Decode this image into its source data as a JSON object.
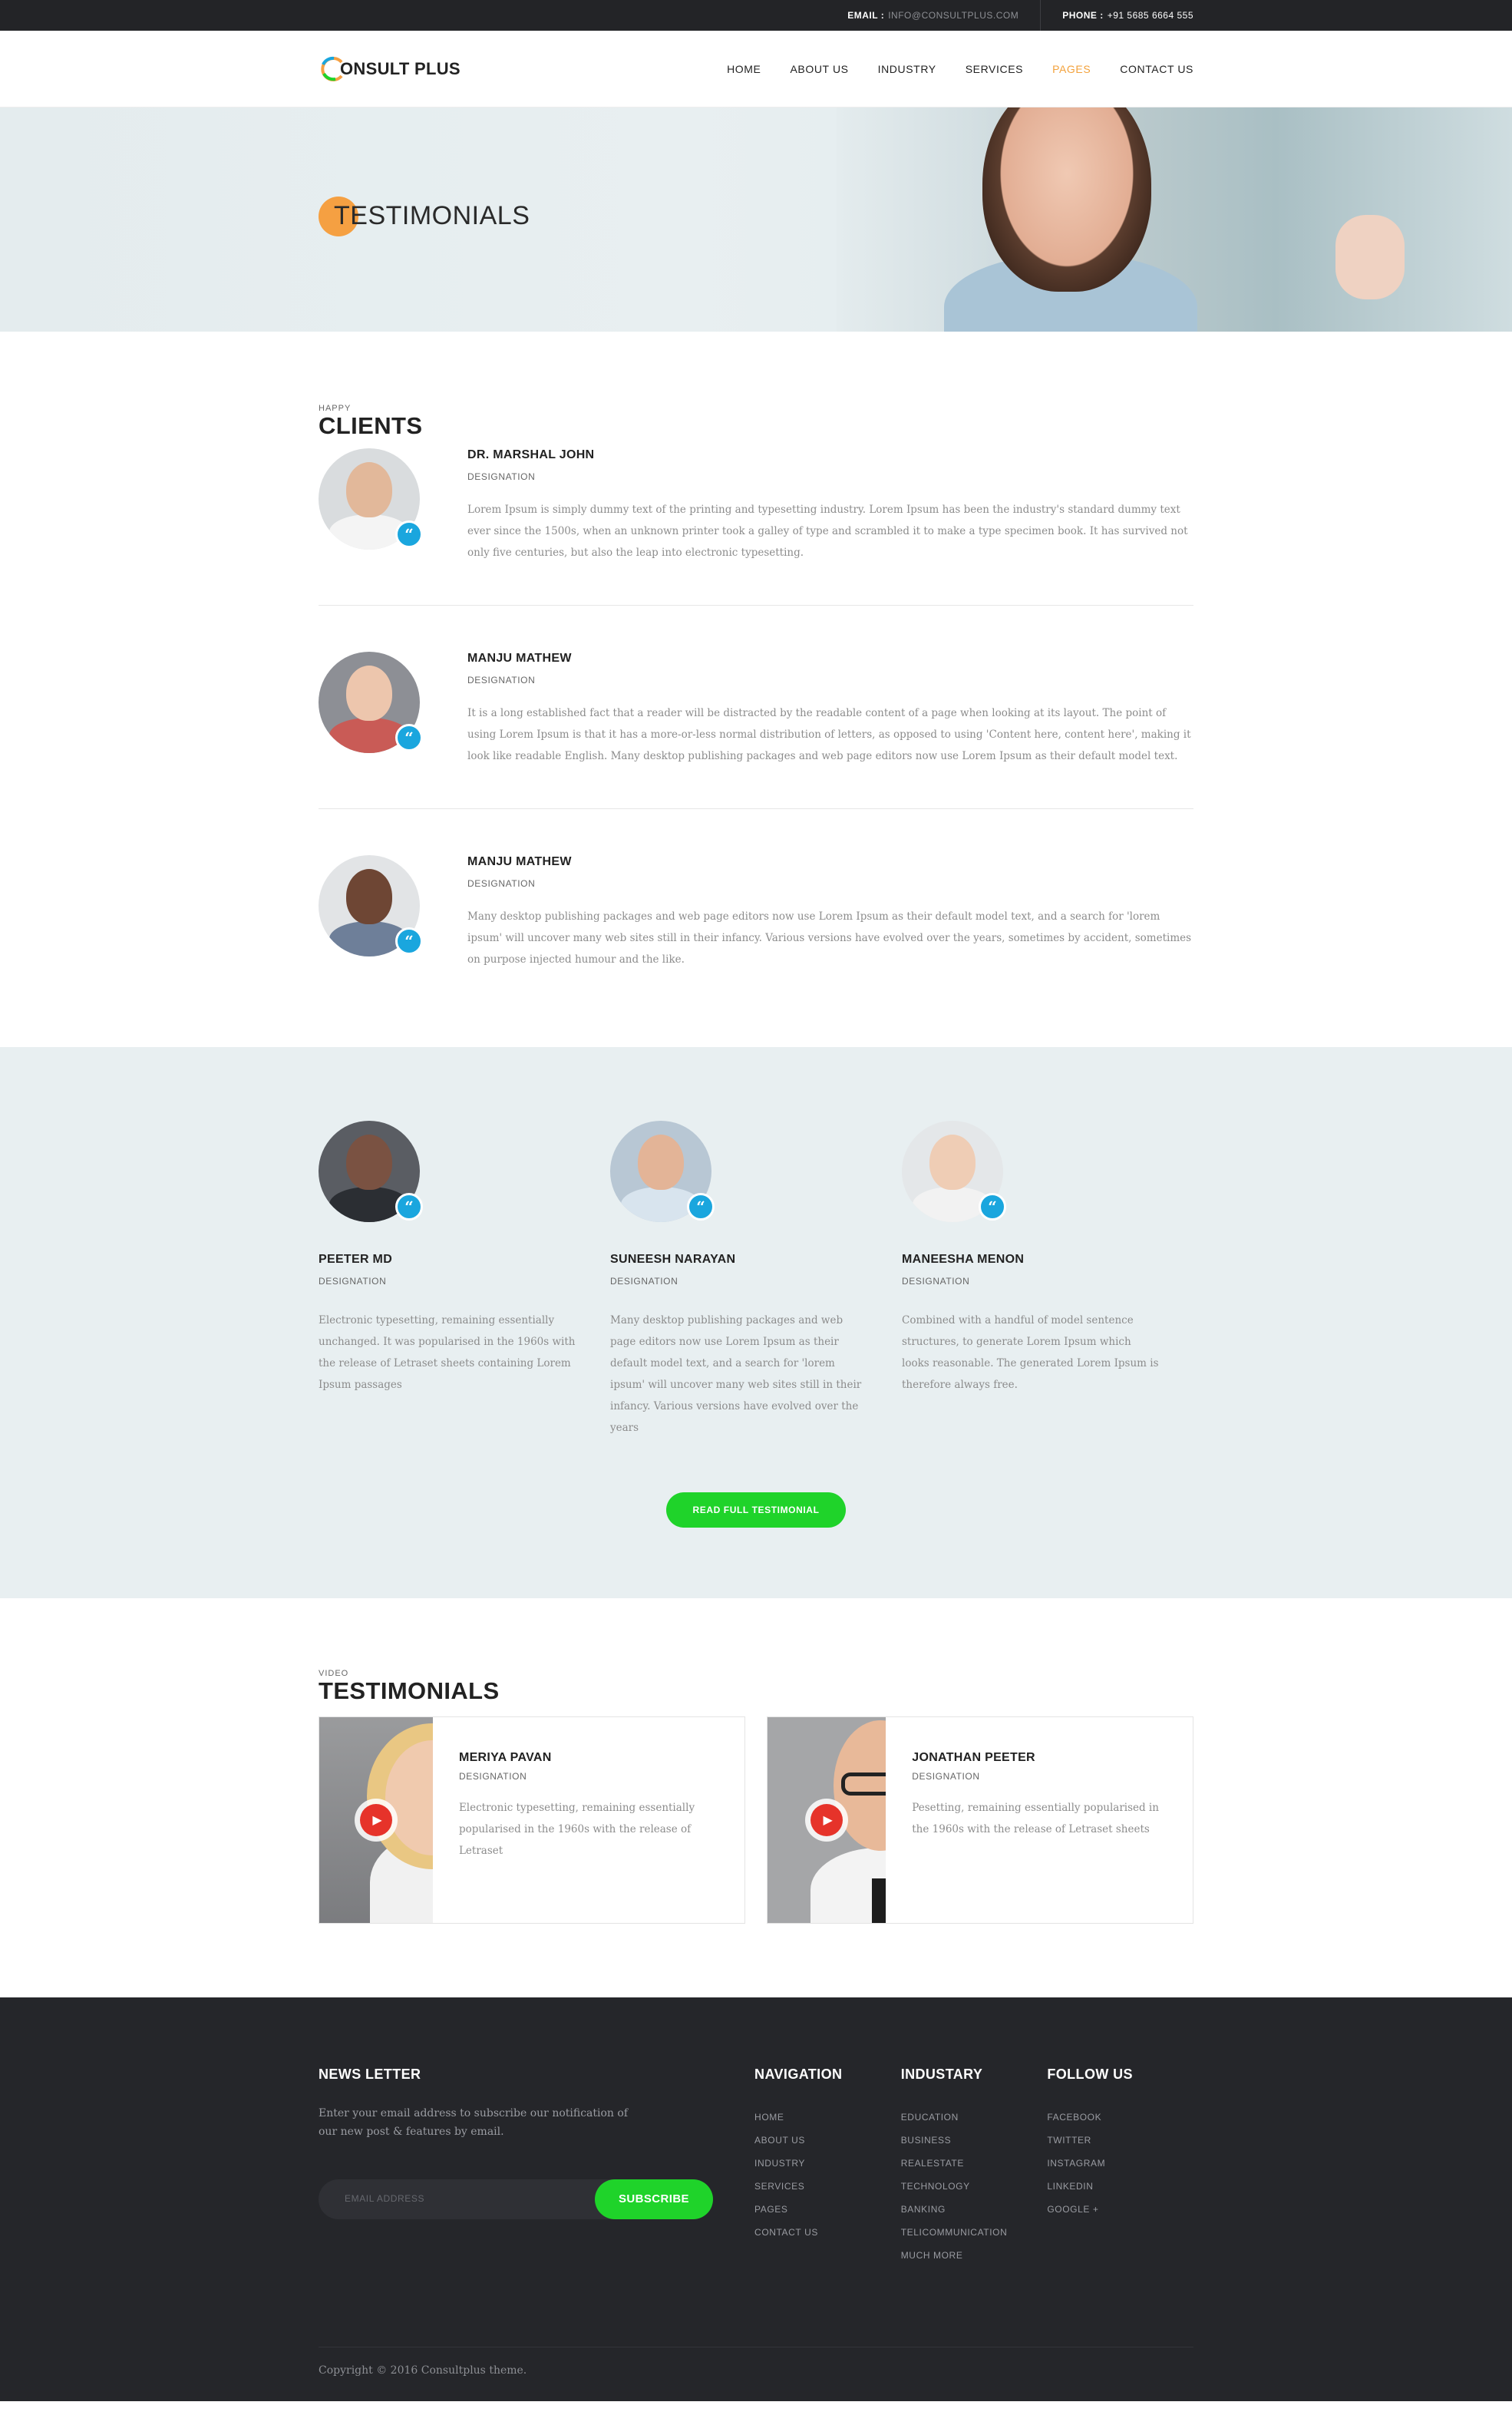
{
  "topbar": {
    "email_label": "EMAIL :",
    "email_value": "INFO@CONSULTPLUS.COM",
    "phone_label": "PHONE :",
    "phone_value": "+91 5685 6664 555"
  },
  "brand": {
    "logo_text": "ONSULT PLUS",
    "accent": "#f5a042"
  },
  "nav": {
    "items": [
      "HOME",
      "ABOUT US",
      "INDUSTRY",
      "SERVICES",
      "PAGES",
      "CONTACT US"
    ],
    "active": "PAGES"
  },
  "banner": {
    "title": "TESTIMONIALS"
  },
  "clients": {
    "kicker": "HAPPY",
    "title": "CLIENTS",
    "items": [
      {
        "name": "DR. MARSHAL JOHN",
        "designation": "DESIGNATION",
        "text": "Lorem Ipsum is simply dummy text of the printing and typesetting industry. Lorem Ipsum has been the industry's standard dummy text ever since the 1500s, when an unknown printer took a galley of type and scrambled it to make a type specimen book. It has survived not only five centuries, but also the leap into electronic typesetting."
      },
      {
        "name": "MANJU MATHEW",
        "designation": "DESIGNATION",
        "text": "It is a long established fact that a reader will be distracted by the readable content of a page when looking at its layout. The point of using Lorem Ipsum is that it has a more-or-less normal distribution of letters, as opposed to using 'Content here, content here', making it look like readable English. Many desktop publishing packages and web page editors now use Lorem Ipsum as their default model text."
      },
      {
        "name": "MANJU MATHEW",
        "designation": "DESIGNATION",
        "text": "Many desktop publishing packages and web page editors now use Lorem Ipsum as their default model text, and a search for 'lorem ipsum' will uncover many web sites still in their infancy. Various versions have evolved over the years, sometimes by accident, sometimes on purpose injected humour and the like."
      }
    ]
  },
  "band": {
    "items": [
      {
        "name": "PEETER MD",
        "designation": "DESIGNATION",
        "text": "Electronic typesetting, remaining essentially unchanged. It was popularised in the 1960s with the release of Letraset sheets containing Lorem Ipsum passages"
      },
      {
        "name": "SUNEESH NARAYAN",
        "designation": "DESIGNATION",
        "text": "Many desktop publishing packages and web page editors now use Lorem Ipsum as their default model text, and a search for 'lorem ipsum' will uncover many web sites still in their infancy. Various versions have evolved over the years"
      },
      {
        "name": "MANEESHA MENON",
        "designation": "DESIGNATION",
        "text": "Combined with a handful of model sentence structures, to generate Lorem Ipsum which looks reasonable. The generated Lorem Ipsum is therefore always free."
      }
    ],
    "button": "READ FULL TESTIMONIAL"
  },
  "videos": {
    "kicker": "VIDEO",
    "title": "TESTIMONIALS",
    "items": [
      {
        "name": "MERIYA PAVAN",
        "designation": "DESIGNATION",
        "text": "Electronic typesetting, remaining essentially popularised in the 1960s with the release of Letraset"
      },
      {
        "name": "JONATHAN PEETER",
        "designation": "DESIGNATION",
        "text": "Pesetting, remaining essentially popularised in the 1960s with the release of Letraset sheets"
      }
    ]
  },
  "footer": {
    "newsletter_title": "NEWS LETTER",
    "newsletter_text": "Enter your email address to subscribe our notification of our new post & features by email.",
    "email_placeholder": "EMAIL ADDRESS",
    "subscribe": "SUBSCRIBE",
    "navigation": {
      "title": "NAVIGATION",
      "items": [
        "HOME",
        "ABOUT US",
        "INDUSTRY",
        "SERVICES",
        "PAGES",
        "CONTACT US"
      ]
    },
    "industry": {
      "title": "INDUSTARY",
      "items": [
        "EDUCATION",
        "BUSINESS",
        "REALESTATE",
        "TECHNOLOGY",
        "BANKING",
        "TELICOMMUNICATION",
        "MUCH MORE"
      ]
    },
    "follow": {
      "title": "FOLLOW US",
      "items": [
        "FACEBOOK",
        "TWITTER",
        "INSTAGRAM",
        "LINKEDIN",
        "GOOGLE +"
      ]
    },
    "copyright": "Copyright © 2016 Consultplus theme."
  },
  "colors": {
    "accent_orange": "#f5a042",
    "quote_blue": "#1aa6de",
    "cta_green": "#1fd32a",
    "dark": "#25262a"
  }
}
